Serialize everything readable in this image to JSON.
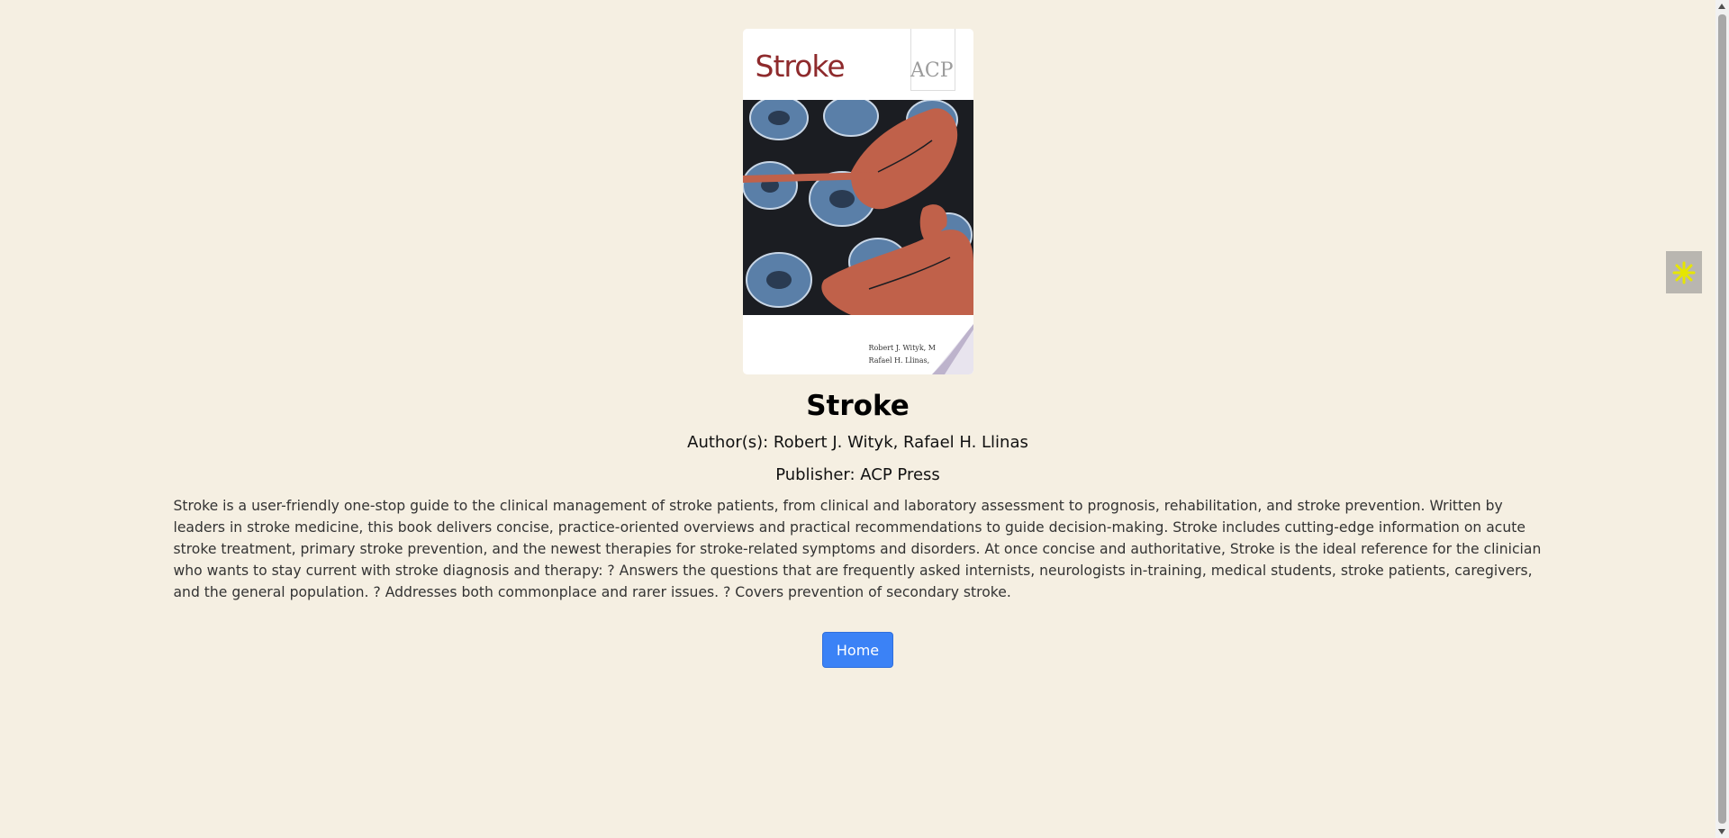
{
  "book": {
    "cover": {
      "title_text": "Stroke",
      "publisher_mark": "ACP",
      "author_line_1": "Robert J. Wityk, M",
      "author_line_2": "Rafael H. Llinas,"
    },
    "title": "Stroke",
    "authors": "Author(s): Robert J. Wityk, Rafael H. Llinas",
    "publisher": "Publisher: ACP Press",
    "description": "Stroke is a user-friendly one-stop guide to the clinical management of stroke patients, from clinical and laboratory assessment to prognosis, rehabilitation, and stroke prevention. Written by leaders in stroke medicine, this book delivers concise, practice-oriented overviews and practical recommendations to guide decision-making. Stroke includes cutting-edge information on acute stroke treatment, primary stroke prevention, and the newest therapies for stroke-related symptoms and disorders. At once concise and authoritative, Stroke is the ideal reference for the clinician who wants to stay current with stroke diagnosis and therapy: ? Answers the questions that are frequently asked internists, neurologists in-training, medical students, stroke patients, caregivers, and the general population. ? Addresses both commonplace and rarer issues. ? Covers prevention of secondary stroke."
  },
  "actions": {
    "home_label": "Home"
  },
  "side_widget": {
    "icon": "asterisk-flower-icon"
  },
  "colors": {
    "background": "#f5efe2",
    "button": "#3b82f6",
    "cover_title": "#8e2a2c",
    "widget_icon": "#e6e600"
  }
}
